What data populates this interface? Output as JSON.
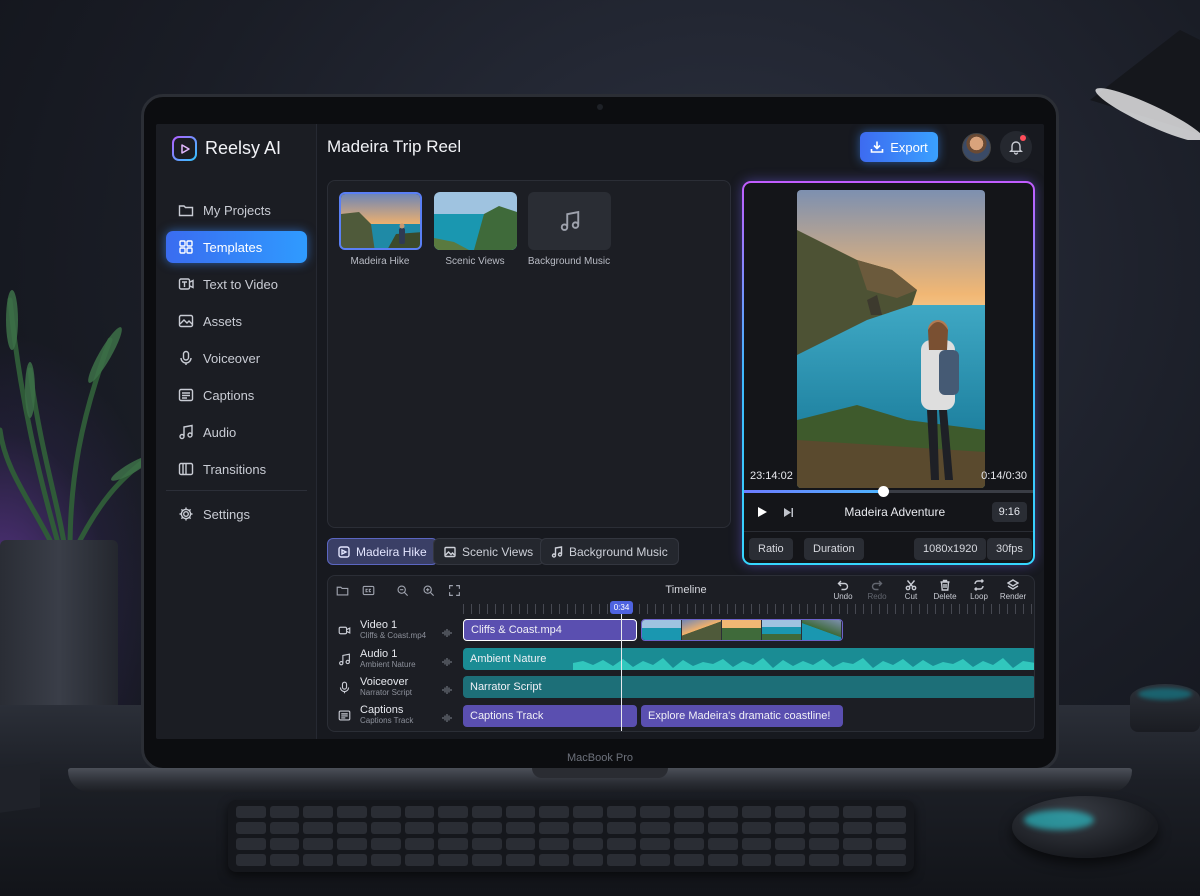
{
  "app": {
    "name": "Reelsy AI",
    "device_label": "MacBook Pro"
  },
  "sidebar": {
    "items": [
      {
        "label": "My Projects",
        "icon": "folder-icon"
      },
      {
        "label": "Templates",
        "icon": "grid-icon",
        "active": true
      },
      {
        "label": "Text to Video",
        "icon": "text-to-video-icon"
      },
      {
        "label": "Assets",
        "icon": "image-icon"
      },
      {
        "label": "Voiceover",
        "icon": "microphone-icon"
      },
      {
        "label": "Captions",
        "icon": "captions-icon"
      },
      {
        "label": "Audio",
        "icon": "music-note-icon"
      },
      {
        "label": "Transitions",
        "icon": "transitions-icon"
      }
    ],
    "settings_label": "Settings"
  },
  "header": {
    "title": "Madeira Trip Reel",
    "export_label": "Export"
  },
  "media": {
    "items": [
      {
        "label": "Madeira Hike",
        "selected": true
      },
      {
        "label": "Scenic Views"
      },
      {
        "label": "Background Music"
      }
    ]
  },
  "chips": [
    {
      "label": "Madeira Hike",
      "active": true
    },
    {
      "label": "Scenic Views"
    },
    {
      "label": "Background Music"
    }
  ],
  "preview": {
    "time_current": "23:14:02",
    "time_position": "0:14/0:30",
    "progress": 0.48,
    "title": "Madeira Adventure",
    "aspect": "9:16",
    "ratio_label": "Ratio",
    "duration_label": "Duration",
    "resolution": "1080x1920",
    "fps": "30fps"
  },
  "timeline": {
    "title": "Timeline",
    "playhead": "0:34",
    "actions": [
      {
        "label": "Undo",
        "icon": "undo-icon"
      },
      {
        "label": "Redo",
        "icon": "redo-icon",
        "disabled": true
      },
      {
        "label": "Cut",
        "icon": "scissors-icon"
      },
      {
        "label": "Delete",
        "icon": "trash-icon"
      },
      {
        "label": "Loop",
        "icon": "loop-icon"
      },
      {
        "label": "Render",
        "icon": "render-icon"
      }
    ],
    "tracks": [
      {
        "name": "Video 1",
        "sub": "Cliffs & Coast.mp4",
        "icon": "video-camera-icon"
      },
      {
        "name": "Audio 1",
        "sub": "Ambient Nature",
        "icon": "music-note-icon"
      },
      {
        "name": "Voiceover",
        "sub": "Narrator Script",
        "icon": "microphone-icon"
      },
      {
        "name": "Captions",
        "sub": "Captions Track",
        "icon": "captions-icon"
      }
    ],
    "clips": {
      "video": "Cliffs & Coast.mp4",
      "audio": "Ambient Nature",
      "voiceover": "Narrator Script",
      "captions_1": "Captions Track",
      "captions_2": "Explore Madeira's dramatic coastline!"
    }
  },
  "colors": {
    "accent": "#3a8cff",
    "glow_purple": "#c35cff",
    "glow_cyan": "#36d6ff",
    "clip_purple": "#5a4fb0",
    "clip_teal": "#1a8c94"
  }
}
